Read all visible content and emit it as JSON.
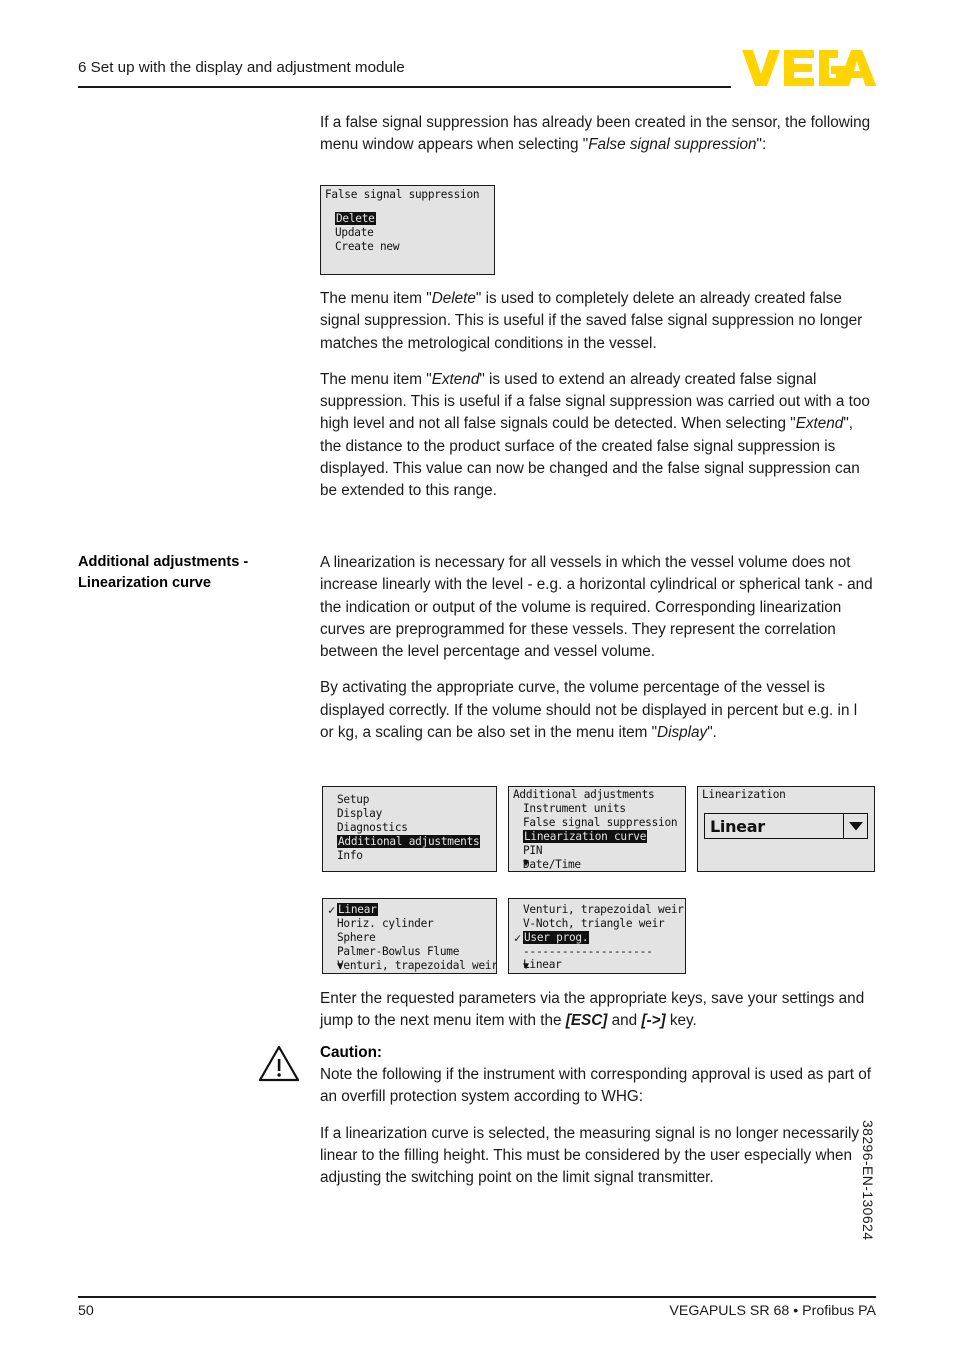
{
  "header": {
    "chapter_title": "6 Set up with the display and adjustment module",
    "logo_text": "VEGA",
    "logo_color": "#FFD400"
  },
  "body": {
    "para1_a": "If a false signal suppression has already been created in the sensor, the following menu window appears when selecting \"",
    "para1_em": "False signal suppression",
    "para1_b": "\":",
    "para2_a": "The menu item \"",
    "para2_em": "Delete",
    "para2_b": "\" is used to completely delete an already created false signal suppression. This is useful if the saved false signal suppression no longer matches the metrological conditions in the vessel.",
    "para3_a": "The menu item \"",
    "para3_em1": "Extend",
    "para3_b": "\" is used to extend an already created false signal suppression. This is useful if a false signal suppression was carried out with a too high level and not all false signals could be detected. When selecting \"",
    "para3_em2": "Extend",
    "para3_c": "\", the distance to the product surface of the created false signal suppression is displayed. This value can now be changed and the false signal suppression can be extended to this range.",
    "margin_heading_line1": "Additional adjustments -",
    "margin_heading_line2": "Linearization curve",
    "para4": "A linearization is necessary for all vessels in which the vessel volume does not increase linearly with the level - e.g. a horizontal cylindrical or spherical tank - and the indication or output of the volume is required. Corresponding linearization curves are preprogrammed for these vessels. They represent the correlation between the level percentage and vessel volume.",
    "para5_a": "By activating the appropriate curve, the volume percentage of the vessel is displayed correctly. If the volume should not be displayed in percent but e.g. in l or kg, a scaling can be also set in the menu item \"",
    "para5_em": "Display",
    "para5_b": "\".",
    "para6_a": "Enter the requested parameters via the appropriate keys, save your settings and jump to the next menu item with the ",
    "para6_key1": "[ESC]",
    "para6_mid": " and ",
    "para6_key2": "[->]",
    "para6_b": " key.",
    "caution_title": "Caution:",
    "para7": "Note the following if the instrument with corresponding approval is used as part of an overfill protection system according to WHG:",
    "para8": "If a linearization curve is selected, the measuring signal is no longer necessarily linear to the filling height. This must be considered by the user especially when adjusting the switching point on the limit signal transmitter."
  },
  "displays": {
    "fss": {
      "title": "False signal suppression",
      "items": [
        {
          "label": "Delete",
          "selected": true
        },
        {
          "label": "Update",
          "selected": false
        },
        {
          "label": "Create new",
          "selected": false
        }
      ]
    },
    "main_menu": {
      "items": [
        {
          "label": "Setup",
          "selected": false
        },
        {
          "label": "Display",
          "selected": false
        },
        {
          "label": "Diagnostics",
          "selected": false
        },
        {
          "label": "Additional adjustments",
          "selected": true
        },
        {
          "label": "Info",
          "selected": false
        }
      ]
    },
    "additional_adjustments": {
      "title": "Additional adjustments",
      "items": [
        {
          "label": "Instrument units",
          "selected": false
        },
        {
          "label": "False signal suppression",
          "selected": false
        },
        {
          "label": "Linearization curve",
          "selected": true
        },
        {
          "label": "PIN",
          "selected": false
        },
        {
          "label": "Date/Time",
          "selected": false
        }
      ],
      "more_indicator": "▼"
    },
    "linearization": {
      "title": "Linearization",
      "dropdown_value": "Linear",
      "dropdown_icon": "chevron-down"
    },
    "curve_list_1": {
      "items": [
        {
          "label": "Linear",
          "selected": true,
          "checked": true
        },
        {
          "label": "Horiz. cylinder",
          "selected": false,
          "checked": false
        },
        {
          "label": "Sphere",
          "selected": false,
          "checked": false
        },
        {
          "label": "Palmer-Bowlus Flume",
          "selected": false,
          "checked": false
        },
        {
          "label": "Venturi, trapezoidal weir",
          "selected": false,
          "checked": false
        }
      ],
      "more_indicator": "▼"
    },
    "curve_list_2": {
      "items": [
        {
          "label": "Venturi, trapezoidal weir",
          "selected": false,
          "checked": false
        },
        {
          "label": "V-Notch, triangle weir",
          "selected": false,
          "checked": false
        },
        {
          "label": "User prog.",
          "selected": true,
          "checked": true
        }
      ],
      "separator": "--------------------",
      "items_after": [
        {
          "label": "Linear",
          "selected": false,
          "checked": false
        }
      ],
      "more_indicator": "▼"
    }
  },
  "footer": {
    "page_number": "50",
    "product_line": "VEGAPULS SR 68 • Profibus PA",
    "doc_code": "38296-EN-130624"
  }
}
